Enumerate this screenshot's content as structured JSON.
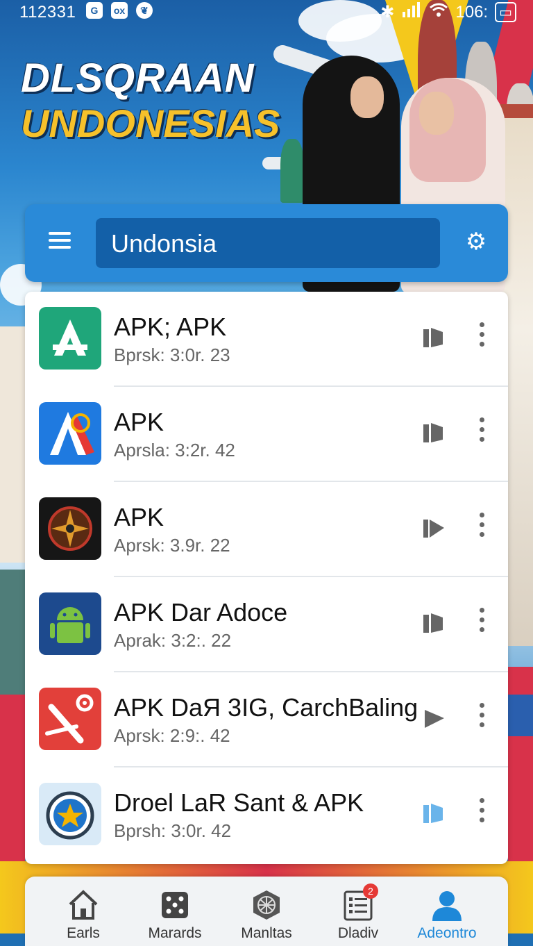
{
  "status_bar": {
    "time": "112331",
    "left_icons": [
      "G",
      "ox",
      "leaf"
    ],
    "right_text": "106:"
  },
  "banner": {
    "line1": "DLSQRAAN",
    "line2": "UNDONESIAS"
  },
  "header": {
    "search_value": "Undonsia"
  },
  "apps": [
    {
      "name": "APK; APK",
      "version": "Bprsk: 3:0r. 23",
      "icon": "app-store-a-icon",
      "action": "pause-icon",
      "action_color": "#666666"
    },
    {
      "name": "APK",
      "version": "Aprsla: 3:2r. 42",
      "icon": "app-red-a-icon",
      "action": "pause-icon",
      "action_color": "#666666"
    },
    {
      "name": "APK",
      "version": "Aprsk: 3.9r. 22",
      "icon": "compass-icon",
      "action": "play-icon",
      "action_color": "#666666"
    },
    {
      "name": "APK Dar Adoce",
      "version": "Aprak: 3:2:. 22",
      "icon": "android-icon",
      "action": "pause-icon",
      "action_color": "#666666"
    },
    {
      "name": "APK DaЯ 3IG, CarchBaling",
      "version": "Aprsk: 2:9:. 42",
      "icon": "settings-tools-icon",
      "action": "play-icon",
      "action_color": "#666666"
    },
    {
      "name": "Droel LaR Sant & APK",
      "version": "Bprsh: 3:0r. 42",
      "icon": "star-badge-icon",
      "action": "pause-icon",
      "action_color": "#6ab4ea"
    }
  ],
  "bottom_nav": [
    {
      "label": "Earls",
      "icon": "home-icon",
      "active": false
    },
    {
      "label": "Marards",
      "icon": "dice-icon",
      "active": false
    },
    {
      "label": "Manltas",
      "icon": "globe-icon",
      "active": false
    },
    {
      "label": "Dladiv",
      "icon": "list-icon",
      "active": false,
      "badge": "2"
    },
    {
      "label": "Adeontro",
      "icon": "profile-icon",
      "active": true
    }
  ],
  "colors": {
    "accent": "#2a8ad8",
    "search_bg": "#1360a8",
    "banner_yellow": "#f6c12b",
    "active_nav": "#1e88d8"
  }
}
